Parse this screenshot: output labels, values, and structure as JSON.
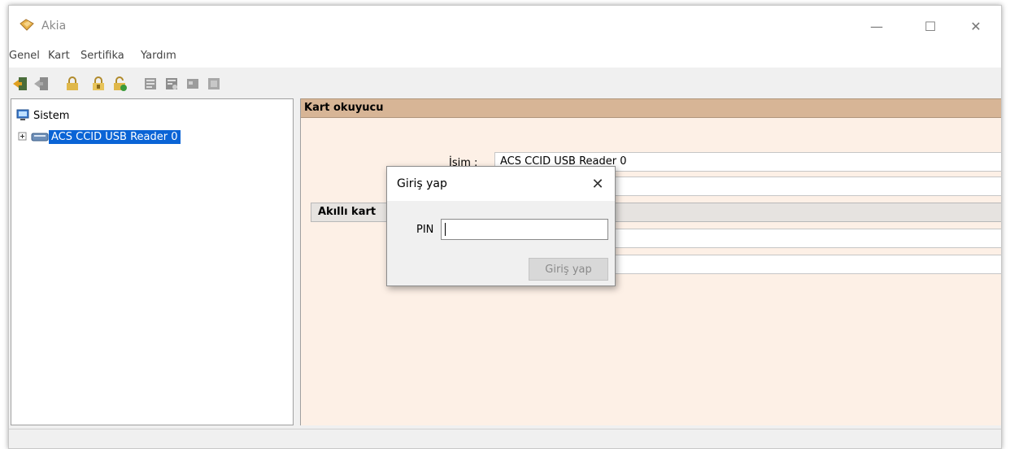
{
  "window": {
    "title": "Akia",
    "controls": [
      "minimize-icon",
      "maximize-icon",
      "close-icon"
    ]
  },
  "menu": {
    "items": [
      "Genel",
      "Kart",
      "Sertifika",
      "Yardım"
    ]
  },
  "toolbar": {
    "icons": [
      "login-icon",
      "logout-icon",
      "lock-icon",
      "lock-alt-icon",
      "unlock-icon",
      "key-icon",
      "certificate-icon",
      "card-icon",
      "card-disabled-icon"
    ]
  },
  "tree": {
    "root": "Sistem",
    "child": "ACS CCID USB Reader 0"
  },
  "main": {
    "reader_header": "Kart okuyucu",
    "name_label": "İsim :",
    "name_value": "ACS CCID USB Reader 0",
    "smartcard_header": "Akıllı kart"
  },
  "dialog": {
    "title": "Giriş yap",
    "pin_label": "PIN",
    "pin_value": "",
    "submit_label": "Giriş yap"
  },
  "colors": {
    "selection": "#0a64d6",
    "header": "#d7b596",
    "panel_bg": "#fdf0e6"
  }
}
